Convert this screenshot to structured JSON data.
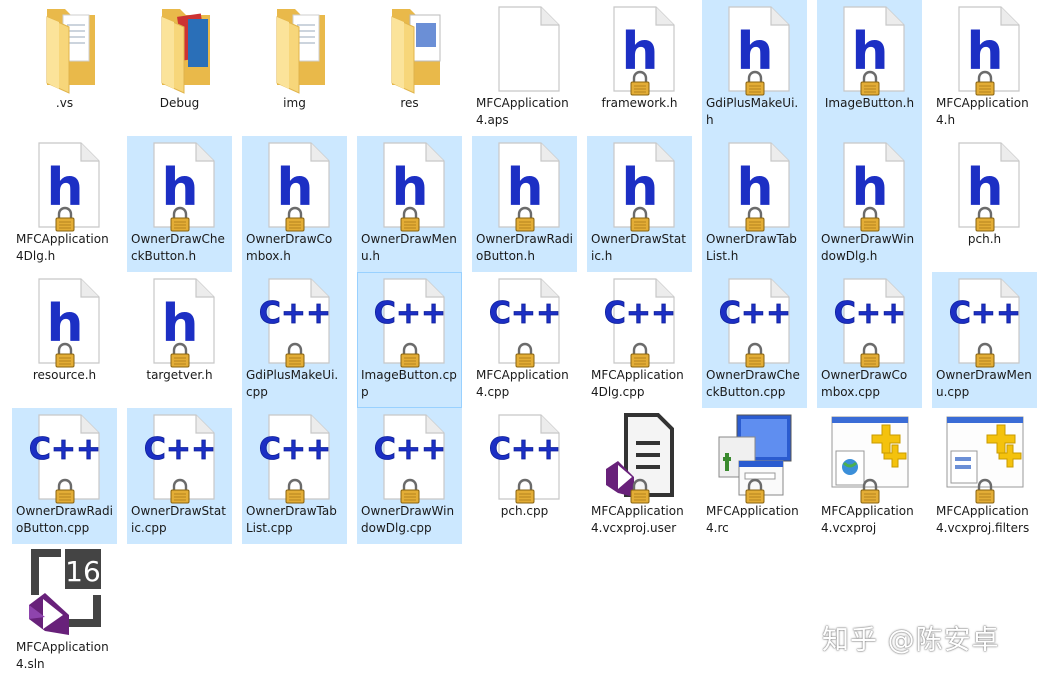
{
  "files": [
    {
      "name": ".vs",
      "icon": "folder-icon",
      "selected": false
    },
    {
      "name": "Debug",
      "icon": "folder-icon",
      "selected": false
    },
    {
      "name": "img",
      "icon": "folder-icon",
      "selected": false
    },
    {
      "name": "res",
      "icon": "folder-icon",
      "selected": false
    },
    {
      "name": "MFCApplication4.aps",
      "icon": "blank-file-icon",
      "selected": false
    },
    {
      "name": "framework.h",
      "icon": "h-file-icon",
      "selected": false
    },
    {
      "name": "GdiPlusMakeUi.h",
      "icon": "h-file-icon",
      "selected": true
    },
    {
      "name": "ImageButton.h",
      "icon": "h-file-icon",
      "selected": true
    },
    {
      "name": "MFCApplication4.h",
      "icon": "h-file-icon",
      "selected": false
    },
    {
      "name": "MFCApplication4Dlg.h",
      "icon": "h-file-icon",
      "selected": false
    },
    {
      "name": "OwnerDrawCheckButton.h",
      "icon": "h-file-icon",
      "selected": true
    },
    {
      "name": "OwnerDrawCombox.h",
      "icon": "h-file-icon",
      "selected": true
    },
    {
      "name": "OwnerDrawMenu.h",
      "icon": "h-file-icon",
      "selected": true
    },
    {
      "name": "OwnerDrawRadioButton.h",
      "icon": "h-file-icon",
      "selected": true
    },
    {
      "name": "OwnerDrawStatic.h",
      "icon": "h-file-icon",
      "selected": true
    },
    {
      "name": "OwnerDrawTabList.h",
      "icon": "h-file-icon",
      "selected": true
    },
    {
      "name": "OwnerDrawWindowDlg.h",
      "icon": "h-file-icon",
      "selected": true
    },
    {
      "name": "pch.h",
      "icon": "h-file-icon",
      "selected": false
    },
    {
      "name": "resource.h",
      "icon": "h-file-icon",
      "selected": false
    },
    {
      "name": "targetver.h",
      "icon": "h-file-icon",
      "selected": false
    },
    {
      "name": "GdiPlusMakeUi.cpp",
      "icon": "cpp-file-icon",
      "selected": true
    },
    {
      "name": "ImageButton.cpp",
      "icon": "cpp-file-icon",
      "selected": true,
      "focus": true
    },
    {
      "name": "MFCApplication4.cpp",
      "icon": "cpp-file-icon",
      "selected": false
    },
    {
      "name": "MFCApplication4Dlg.cpp",
      "icon": "cpp-file-icon",
      "selected": false
    },
    {
      "name": "OwnerDrawCheckButton.cpp",
      "icon": "cpp-file-icon",
      "selected": true
    },
    {
      "name": "OwnerDrawCombox.cpp",
      "icon": "cpp-file-icon",
      "selected": true
    },
    {
      "name": "OwnerDrawMenu.cpp",
      "icon": "cpp-file-icon",
      "selected": true
    },
    {
      "name": "OwnerDrawRadioButton.cpp",
      "icon": "cpp-file-icon",
      "selected": true
    },
    {
      "name": "OwnerDrawStatic.cpp",
      "icon": "cpp-file-icon",
      "selected": true
    },
    {
      "name": "OwnerDrawTabList.cpp",
      "icon": "cpp-file-icon",
      "selected": true
    },
    {
      "name": "OwnerDrawWindowDlg.cpp",
      "icon": "cpp-file-icon",
      "selected": true
    },
    {
      "name": "pch.cpp",
      "icon": "cpp-file-icon",
      "selected": false
    },
    {
      "name": "MFCApplication4.vcxproj.user",
      "icon": "vcxproj-user-icon",
      "selected": false
    },
    {
      "name": "MFCApplication4.rc",
      "icon": "rc-file-icon",
      "selected": false
    },
    {
      "name": "MFCApplication4.vcxproj",
      "icon": "vcxproj-icon",
      "selected": false
    },
    {
      "name": "MFCApplication4.vcxproj.filters",
      "icon": "vcxproj-filters-icon",
      "selected": false
    },
    {
      "name": "MFCApplication4.sln",
      "icon": "vs-solution-icon",
      "selected": false
    }
  ],
  "watermark": "知乎 @陈安卓",
  "colors": {
    "selection": "#cce8ff",
    "focus_border": "#99d1ff",
    "h_letter": "#1c2fc4",
    "cpp_text": "#1c2fc4",
    "folder": "#f8d775",
    "lock": "#d9a22e",
    "vs_purple": "#68217a"
  }
}
